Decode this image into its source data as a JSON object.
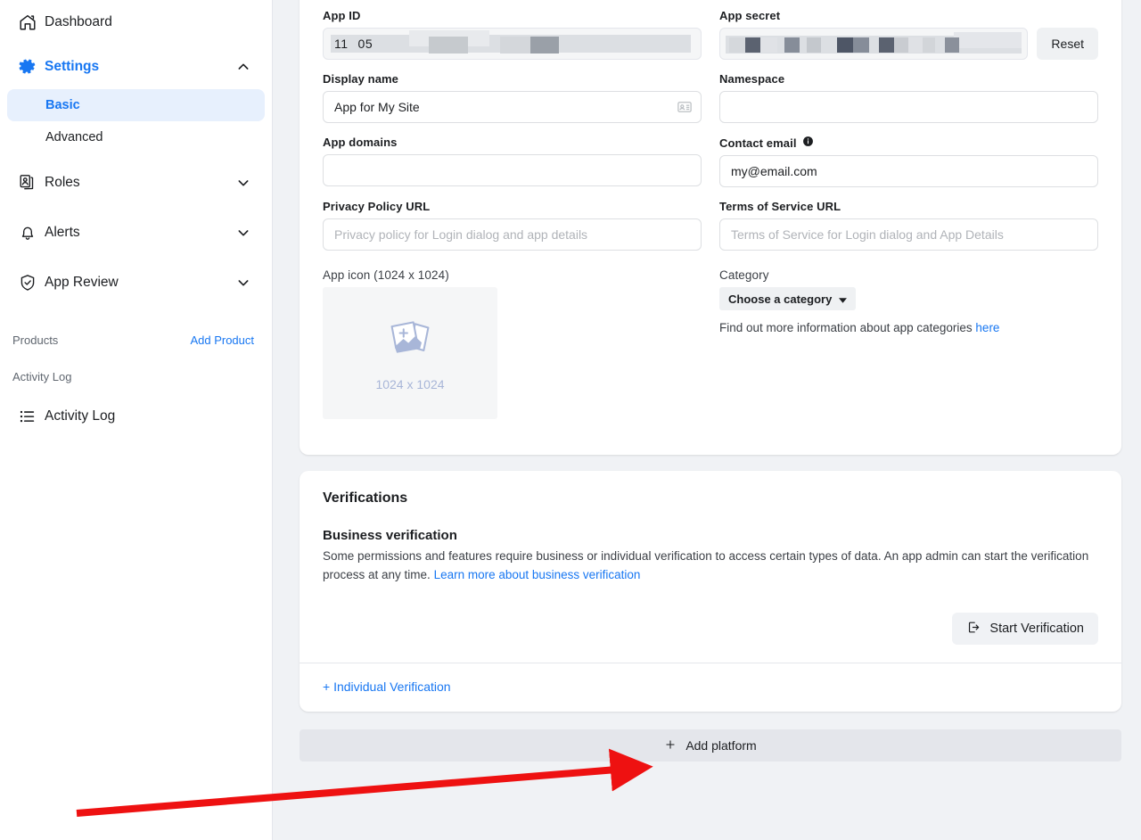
{
  "sidebar": {
    "items": [
      {
        "label": "Dashboard",
        "icon": "home-icon",
        "expandable": false
      },
      {
        "label": "Settings",
        "icon": "gear-icon",
        "expandable": true,
        "expanded": true,
        "active": true
      },
      {
        "label": "Roles",
        "icon": "id-cards-icon",
        "expandable": true,
        "expanded": false
      },
      {
        "label": "Alerts",
        "icon": "bell-icon",
        "expandable": true,
        "expanded": false
      },
      {
        "label": "App Review",
        "icon": "shield-check-icon",
        "expandable": true,
        "expanded": false
      }
    ],
    "settings_sub": [
      {
        "label": "Basic",
        "selected": true
      },
      {
        "label": "Advanced",
        "selected": false
      }
    ],
    "products_section": {
      "title": "Products",
      "action": "Add Product"
    },
    "activity_section": {
      "title": "Activity Log"
    },
    "activity_item": {
      "label": "Activity Log",
      "icon": "list-icon"
    }
  },
  "basic_settings": {
    "app_id": {
      "label": "App ID",
      "value": "11          05",
      "redacted": true
    },
    "app_secret": {
      "label": "App secret",
      "value": "",
      "redacted": true,
      "reset_label": "Reset"
    },
    "display_name": {
      "label": "Display name",
      "value": "App for My Site",
      "icon": "contact-card-icon"
    },
    "namespace": {
      "label": "Namespace",
      "value": "",
      "placeholder": ""
    },
    "app_domains": {
      "label": "App domains",
      "value": "",
      "placeholder": ""
    },
    "contact_email": {
      "label": "Contact email",
      "value": "my@email.com",
      "info_icon": "info-icon"
    },
    "privacy_policy_url": {
      "label": "Privacy Policy URL",
      "value": "",
      "placeholder": "Privacy policy for Login dialog and app details"
    },
    "terms_of_service_url": {
      "label": "Terms of Service URL",
      "value": "",
      "placeholder": "Terms of Service for Login dialog and App Details"
    },
    "app_icon": {
      "label": "App icon (1024 x 1024)",
      "caption": "1024 x 1024",
      "icon": "add-photo-icon"
    },
    "category": {
      "label": "Category",
      "selected": "Choose a category",
      "note_prefix": "Find out more information about app categories ",
      "note_link": "here"
    }
  },
  "verifications": {
    "title": "Verifications",
    "business": {
      "heading": "Business verification",
      "description": "Some permissions and features require business or individual verification to access certain types of data. An app admin can start the verification process at any time. ",
      "link": "Learn more about business verification",
      "button": "Start Verification",
      "button_icon": "external-link-icon"
    },
    "individual_link": "+ Individual Verification"
  },
  "add_platform": {
    "label": "Add platform",
    "icon": "plus-icon"
  },
  "annotation": {
    "type": "red-arrow",
    "color": "#ee1111",
    "points_to": "add-platform-button"
  },
  "colors": {
    "accent_blue": "#1877f2",
    "page_bg": "#f0f2f5",
    "card_bg": "#ffffff",
    "selected_nav_bg": "#e7f0fd",
    "text_primary": "#1c1e21",
    "text_secondary": "#606770",
    "annotation_red": "#ee1111"
  }
}
